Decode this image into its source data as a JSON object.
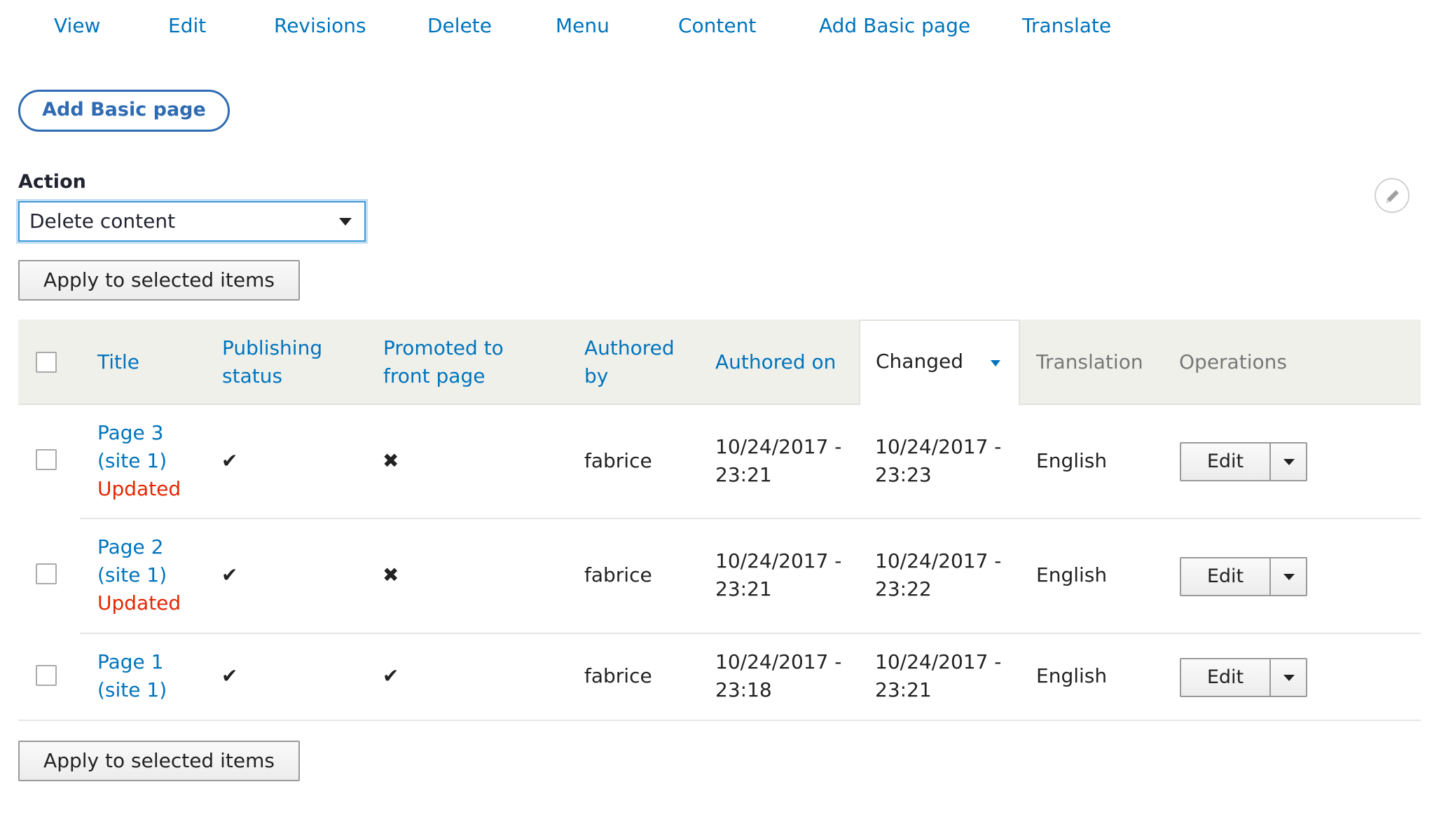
{
  "tabs": [
    "View",
    "Edit",
    "Revisions",
    "Delete",
    "Menu",
    "Content",
    "Add Basic page",
    "Translate"
  ],
  "add_button": "Add Basic page",
  "action": {
    "label": "Action",
    "selected": "Delete content"
  },
  "apply_button": "Apply to selected items",
  "table": {
    "headers": {
      "title": "Title",
      "publishing_status": [
        "Publishing",
        "status"
      ],
      "promoted": [
        "Promoted to",
        "front page"
      ],
      "authored_by": [
        "Authored",
        "by"
      ],
      "authored_on": "Authored on",
      "changed": "Changed",
      "translation": "Translation",
      "operations": "Operations"
    },
    "rows": [
      {
        "title": [
          "Page 3",
          "(site 1)"
        ],
        "flag": "Updated",
        "published": "✔",
        "promoted": "✖",
        "author": "fabrice",
        "authored_on": [
          "10/24/2017 -",
          "23:21"
        ],
        "changed": [
          "10/24/2017 -",
          "23:23"
        ],
        "translation": "English",
        "operation": "Edit"
      },
      {
        "title": [
          "Page 2",
          "(site 1)"
        ],
        "flag": "Updated",
        "published": "✔",
        "promoted": "✖",
        "author": "fabrice",
        "authored_on": [
          "10/24/2017 -",
          "23:21"
        ],
        "changed": [
          "10/24/2017 -",
          "23:22"
        ],
        "translation": "English",
        "operation": "Edit"
      },
      {
        "title": [
          "Page 1",
          "(site 1)"
        ],
        "flag": "",
        "published": "✔",
        "promoted": "✔",
        "author": "fabrice",
        "authored_on": [
          "10/24/2017 -",
          "23:18"
        ],
        "changed": [
          "10/24/2017 -",
          "23:21"
        ],
        "translation": "English",
        "operation": "Edit"
      }
    ]
  },
  "colors": {
    "link": "#0074bd",
    "updated": "#e62600",
    "header_bg": "#f0f0eb",
    "pill_border": "#2f6bb2"
  },
  "icons": {
    "contextual": "pencil-icon",
    "dropdown": "chevron-down-icon"
  }
}
